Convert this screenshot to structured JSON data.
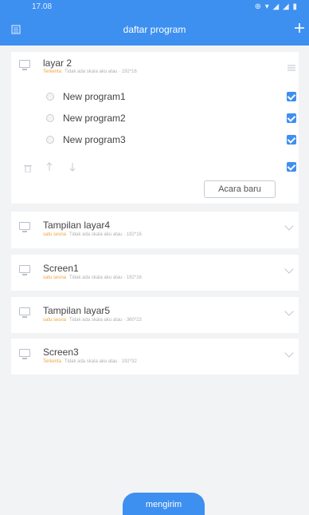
{
  "status_bar": {
    "time": "17.08",
    "right": "⊕ ▾ ◢ ◢ ▮"
  },
  "header": {
    "title": "daftar program"
  },
  "screens": [
    {
      "name": "layar 2",
      "status": "Terkenta",
      "info": "Tidak ada skala aku atau · 192*16",
      "expanded": true
    },
    {
      "name": "Tampilan layar4",
      "status": "satu sesna",
      "info": "Tidak ada skala aku atau · 192*16"
    },
    {
      "name": "Screen1",
      "status": "satu sesna",
      "info": "Tidak ada skala aku atau · 192*16"
    },
    {
      "name": "Tampilan layar5",
      "status": "satu sesna",
      "info": "Tidak ada skala aku atau · 360*23"
    },
    {
      "name": "Screen3",
      "status": "Terkenta",
      "info": "Tidak ada skala aku atau · 192*32"
    }
  ],
  "programs": [
    {
      "name": "New program1",
      "checked": true
    },
    {
      "name": "New program2",
      "checked": true
    },
    {
      "name": "New program3",
      "checked": true
    }
  ],
  "actions": {
    "new_program": "Acara baru",
    "send": "mengirim"
  }
}
